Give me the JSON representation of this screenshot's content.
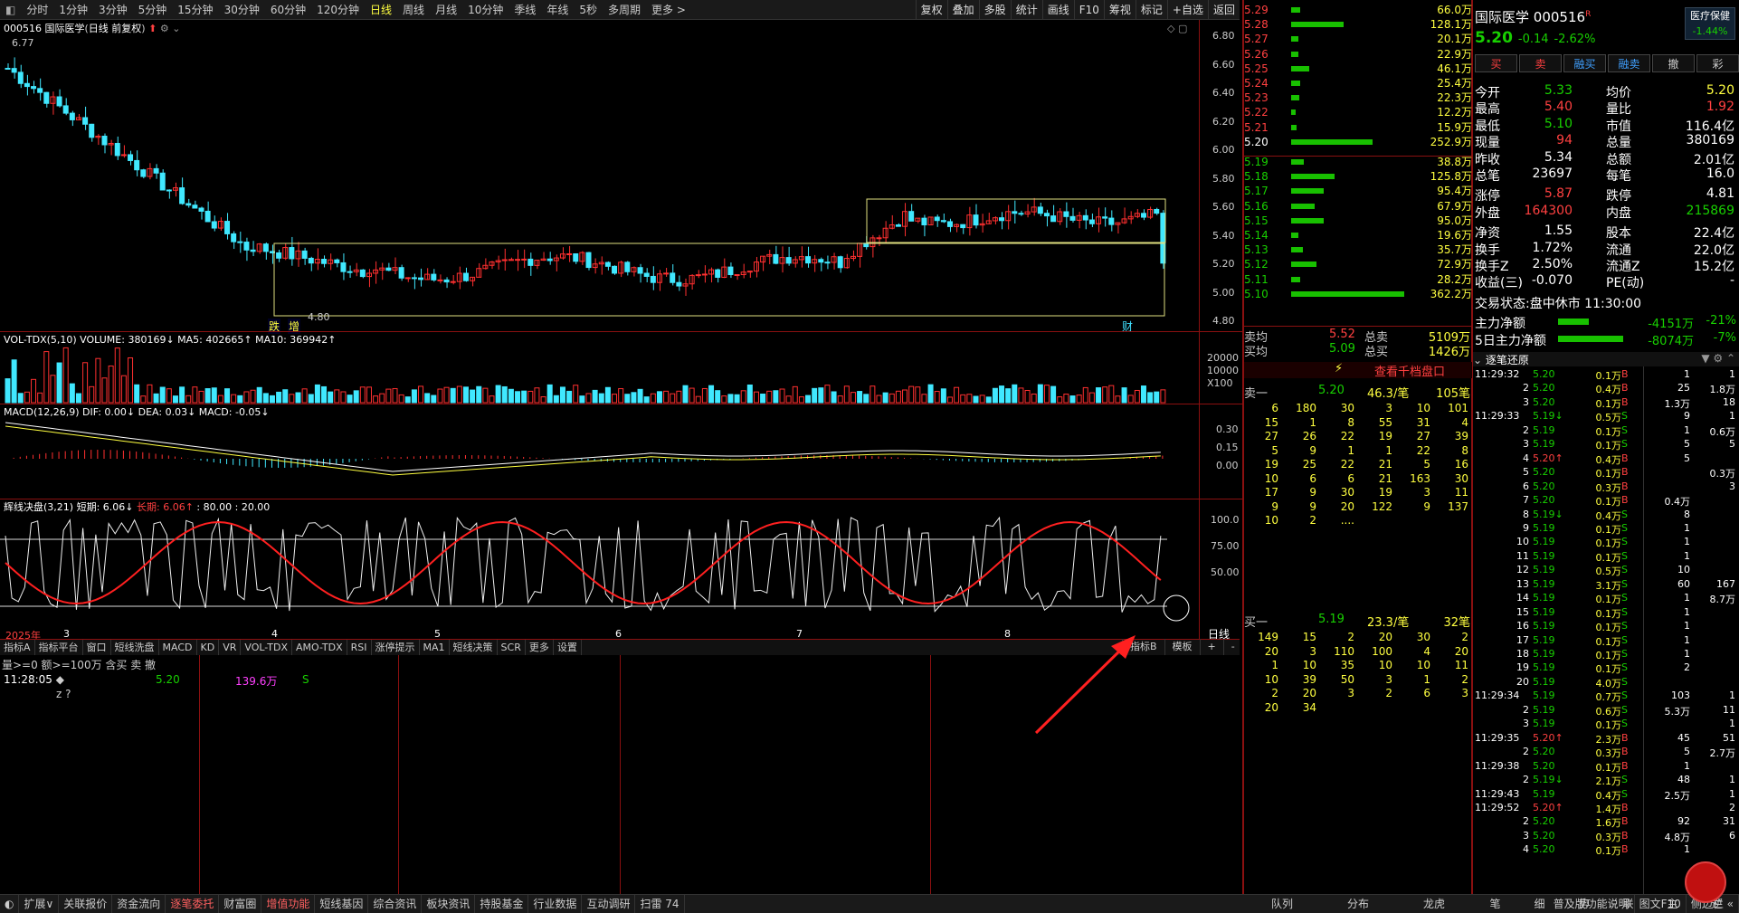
{
  "stock": {
    "code": "000516",
    "name": "国际医学",
    "chart_mode": "日线 前复权",
    "price": "5.20",
    "change": "-0.14",
    "pct": "-2.62%",
    "sector": "医疗保健",
    "sector_pct": "-1.44%"
  },
  "periods": [
    "分时",
    "1分钟",
    "3分钟",
    "5分钟",
    "15分钟",
    "30分钟",
    "60分钟",
    "120分钟",
    "日线",
    "周线",
    "月线",
    "10分钟",
    "季线",
    "年线",
    "5秒",
    "多周期",
    "更多 >"
  ],
  "period_current": "日线",
  "toolbar": [
    "复权",
    "叠加",
    "多股",
    "统计",
    "画线",
    "F10",
    "筹视",
    "标记",
    "+自选",
    "返回"
  ],
  "main_chart": {
    "price_labels": [
      "6.80",
      "6.60",
      "6.40",
      "6.20",
      "6.00",
      "5.80",
      "5.60",
      "5.40",
      "5.20",
      "5.00",
      "4.80"
    ],
    "high_label": "6.77",
    "low_label": "4.80",
    "markers": [
      "跌",
      "增",
      "财"
    ],
    "date_labels": [
      "2025年",
      "3",
      "4",
      "5",
      "6",
      "7",
      "8"
    ],
    "period_label": "日线"
  },
  "vol": {
    "header": "VOL-TDX(5,10) VOLUME: 380169↓ MA5: 402665↑ MA10: 369942↑",
    "labels": [
      "20000",
      "10000",
      "X100"
    ]
  },
  "macd": {
    "header": "MACD(12,26,9) DIF: 0.00↓ DEA: 0.03↓ MACD: -0.05↓",
    "labels": [
      "0.30",
      "0.15",
      "0.00"
    ]
  },
  "oscillator": {
    "name": "辉线决盘(3,21)",
    "short": "短期: 6.06↓",
    "long": "长期: 6.06↑",
    "levels": ": 80.00 : 20.00",
    "labels": [
      "100.0",
      "75.00",
      "50.00"
    ]
  },
  "ind_tabs": [
    "指标A",
    "指标平台",
    "窗口",
    "短线洗盘",
    "MACD",
    "KD",
    "VR",
    "VOL-TDX",
    "AMO-TDX",
    "RSI",
    "涨停提示",
    "MA1",
    "短线决策",
    "SCR",
    "更多",
    "设置"
  ],
  "ind_right": [
    "指标B",
    "模板",
    "+",
    "-"
  ],
  "filter": {
    "text": "量>=0 额>=100万 含买 卖 撤"
  },
  "filter_row": {
    "time": "11:28:05",
    "price": "5.20",
    "amount": "139.6万",
    "side": "S",
    "note": "z ?"
  },
  "bottom_tabs": [
    "扩展∨",
    "关联报价",
    "资金流向",
    "逐笔委托",
    "财富圈",
    "增值功能",
    "短线基因",
    "综合资讯",
    "板块资讯",
    "持股基金",
    "行业数据",
    "互动调研",
    "扫雷 74"
  ],
  "bottom_right": [
    "普及版功能说明",
    "图文F10",
    "侧边栏 «"
  ],
  "ob_bottom_tabs": [
    "队列",
    "分布",
    "龙虎"
  ],
  "tk_bottom_tabs": [
    "笔",
    "细",
    "势",
    "联",
    "主",
    "逆"
  ],
  "orderbook": [
    {
      "p": "5.29",
      "v": "66.0万",
      "w": 10
    },
    {
      "p": "5.28",
      "v": "128.1万",
      "w": 58
    },
    {
      "p": "5.27",
      "v": "20.1万",
      "w": 8
    },
    {
      "p": "5.26",
      "v": "22.9万",
      "w": 8
    },
    {
      "p": "5.25",
      "v": "46.1万",
      "w": 20
    },
    {
      "p": "5.24",
      "v": "25.4万",
      "w": 10
    },
    {
      "p": "5.23",
      "v": "22.3万",
      "w": 9
    },
    {
      "p": "5.22",
      "v": "12.2万",
      "w": 5
    },
    {
      "p": "5.21",
      "v": "15.9万",
      "w": 6
    },
    {
      "p": "5.20",
      "v": "252.9万",
      "w": 90
    },
    {
      "p": "5.19",
      "v": "38.8万",
      "w": 14
    },
    {
      "p": "5.18",
      "v": "125.8万",
      "w": 48
    },
    {
      "p": "5.17",
      "v": "95.4万",
      "w": 36
    },
    {
      "p": "5.16",
      "v": "67.9万",
      "w": 26
    },
    {
      "p": "5.15",
      "v": "95.0万",
      "w": 36
    },
    {
      "p": "5.14",
      "v": "19.6万",
      "w": 8
    },
    {
      "p": "5.13",
      "v": "35.7万",
      "w": 13
    },
    {
      "p": "5.12",
      "v": "72.9万",
      "w": 28
    },
    {
      "p": "5.11",
      "v": "28.2万",
      "w": 10
    },
    {
      "p": "5.10",
      "v": "362.2万",
      "w": 125
    }
  ],
  "ob_summary": {
    "sell_avg_label": "卖均",
    "sell_avg": "5.52",
    "sell_total_label": "总卖",
    "sell_total": "5109万",
    "buy_avg_label": "买均",
    "buy_avg": "5.09",
    "buy_total_label": "总买",
    "buy_total": "1426万",
    "link": "查看千档盘口"
  },
  "queue_sell": {
    "label": "卖一",
    "price": "5.20",
    "avg": "46.3/笔",
    "count": "105笔",
    "rows": [
      [
        "6",
        "180",
        "30",
        "3",
        "10",
        "101"
      ],
      [
        "15",
        "1",
        "8",
        "55",
        "31",
        "4"
      ],
      [
        "27",
        "26",
        "22",
        "19",
        "27",
        "39"
      ],
      [
        "5",
        "9",
        "1",
        "1",
        "22",
        "8"
      ],
      [
        "19",
        "25",
        "22",
        "21",
        "5",
        "16"
      ],
      [
        "10",
        "6",
        "6",
        "21",
        "163",
        "30"
      ],
      [
        "17",
        "9",
        "30",
        "19",
        "3",
        "11"
      ],
      [
        "9",
        "9",
        "20",
        "122",
        "9",
        "137"
      ],
      [
        "10",
        "2",
        "....",
        "",
        "",
        ""
      ]
    ]
  },
  "queue_buy": {
    "label": "买一",
    "price": "5.19",
    "avg": "23.3/笔",
    "count": "32笔",
    "rows": [
      [
        "149",
        "15",
        "2",
        "20",
        "30",
        "2"
      ],
      [
        "20",
        "3",
        "110",
        "100",
        "4",
        "20"
      ],
      [
        "1",
        "10",
        "35",
        "10",
        "10",
        "11"
      ],
      [
        "10",
        "39",
        "50",
        "3",
        "1",
        "2"
      ],
      [
        "2",
        "20",
        "3",
        "2",
        "6",
        "3"
      ],
      [
        "20",
        "34",
        "",
        "",
        "",
        ""
      ]
    ]
  },
  "trade_buttons": [
    "买",
    "卖",
    "融买",
    "融卖",
    "撤",
    "彩"
  ],
  "quote": [
    [
      "今开",
      "5.33",
      "均价",
      "5.20"
    ],
    [
      "最高",
      "5.40",
      "量比",
      "1.92"
    ],
    [
      "最低",
      "5.10",
      "市值",
      "116.4亿"
    ],
    [
      "现量",
      "94",
      "总量",
      "380169"
    ],
    [
      "昨收",
      "5.34",
      "总额",
      "2.01亿"
    ],
    [
      "总笔",
      "23697",
      "每笔",
      "16.0"
    ],
    [
      "涨停",
      "5.87",
      "跌停",
      "4.81"
    ],
    [
      "外盘",
      "164300",
      "内盘",
      "215869"
    ],
    [
      "净资",
      "1.55",
      "股本",
      "22.4亿"
    ],
    [
      "换手",
      "1.72%",
      "流通",
      "22.0亿"
    ],
    [
      "换手Z",
      "2.50%",
      "流通Z",
      "15.2亿"
    ],
    [
      "收益(三)",
      "-0.070",
      "PE(动)",
      "-"
    ]
  ],
  "status": {
    "label": "交易状态:",
    "value": "盘中休市 11:30:00"
  },
  "flow": [
    {
      "label": "主力净额",
      "value": "-4151万",
      "pct": "-21%"
    },
    {
      "label": "5日主力净额",
      "value": "-8074万",
      "pct": "-7%"
    }
  ],
  "ticks_title": "逐笔还原",
  "ticks": [
    {
      "t": "11:29:32",
      "p": "5.20",
      "v": "0.1万",
      "s": "B",
      "c": "1",
      "e": "1"
    },
    {
      "t": "2",
      "p": "5.20",
      "v": "0.4万",
      "s": "B",
      "c": "25",
      "e": "1.8万"
    },
    {
      "t": "3",
      "p": "5.20",
      "v": "0.1万",
      "s": "B",
      "c": "1.3万",
      "e": "18"
    },
    {
      "t": "11:29:33",
      "p": "5.19↓",
      "v": "0.5万",
      "s": "S",
      "c": "9",
      "e": "1"
    },
    {
      "t": "2",
      "p": "5.19",
      "v": "0.1万",
      "s": "S",
      "c": "1",
      "e": "0.6万"
    },
    {
      "t": "3",
      "p": "5.19",
      "v": "0.1万",
      "s": "S",
      "c": "5",
      "e": "5"
    },
    {
      "t": "4",
      "p": "5.20↑",
      "v": "0.4万",
      "s": "B",
      "c": "5",
      "e": ""
    },
    {
      "t": "5",
      "p": "5.20",
      "v": "0.1万",
      "s": "B",
      "c": "",
      "e": "0.3万"
    },
    {
      "t": "6",
      "p": "5.20",
      "v": "0.3万",
      "s": "B",
      "c": "",
      "e": "3"
    },
    {
      "t": "7",
      "p": "5.20",
      "v": "0.1万",
      "s": "B",
      "c": "0.4万",
      "e": ""
    },
    {
      "t": "8",
      "p": "5.19↓",
      "v": "0.4万",
      "s": "S",
      "c": "8",
      "e": ""
    },
    {
      "t": "9",
      "p": "5.19",
      "v": "0.1万",
      "s": "S",
      "c": "1",
      "e": ""
    },
    {
      "t": "10",
      "p": "5.19",
      "v": "0.1万",
      "s": "S",
      "c": "1",
      "e": ""
    },
    {
      "t": "11",
      "p": "5.19",
      "v": "0.1万",
      "s": "S",
      "c": "1",
      "e": ""
    },
    {
      "t": "12",
      "p": "5.19",
      "v": "0.5万",
      "s": "S",
      "c": "10",
      "e": ""
    },
    {
      "t": "13",
      "p": "5.19",
      "v": "3.1万",
      "s": "S",
      "c": "60",
      "e": "167"
    },
    {
      "t": "14",
      "p": "5.19",
      "v": "0.1万",
      "s": "S",
      "c": "1",
      "e": "8.7万"
    },
    {
      "t": "15",
      "p": "5.19",
      "v": "0.1万",
      "s": "S",
      "c": "1",
      "e": ""
    },
    {
      "t": "16",
      "p": "5.19",
      "v": "0.1万",
      "s": "S",
      "c": "1",
      "e": ""
    },
    {
      "t": "17",
      "p": "5.19",
      "v": "0.1万",
      "s": "S",
      "c": "1",
      "e": ""
    },
    {
      "t": "18",
      "p": "5.19",
      "v": "0.1万",
      "s": "S",
      "c": "1",
      "e": ""
    },
    {
      "t": "19",
      "p": "5.19",
      "v": "0.1万",
      "s": "S",
      "c": "2",
      "e": ""
    },
    {
      "t": "20",
      "p": "5.19",
      "v": "4.0万",
      "s": "S",
      "c": "",
      "e": ""
    },
    {
      "t": "11:29:34",
      "p": "5.19",
      "v": "0.7万",
      "s": "S",
      "c": "103",
      "e": "1"
    },
    {
      "t": "2",
      "p": "5.19",
      "v": "0.6万",
      "s": "S",
      "c": "5.3万",
      "e": "11"
    },
    {
      "t": "3",
      "p": "5.19",
      "v": "0.1万",
      "s": "S",
      "c": "",
      "e": "1"
    },
    {
      "t": "11:29:35",
      "p": "5.20↑",
      "v": "2.3万",
      "s": "B",
      "c": "45",
      "e": "51"
    },
    {
      "t": "2",
      "p": "5.20",
      "v": "0.3万",
      "s": "B",
      "c": "5",
      "e": "2.7万"
    },
    {
      "t": "11:29:38",
      "p": "5.20",
      "v": "0.1万",
      "s": "B",
      "c": "1",
      "e": ""
    },
    {
      "t": "2",
      "p": "5.19↓",
      "v": "2.1万",
      "s": "S",
      "c": "48",
      "e": "1"
    },
    {
      "t": "11:29:43",
      "p": "5.19",
      "v": "0.4万",
      "s": "S",
      "c": "2.5万",
      "e": "1"
    },
    {
      "t": "11:29:52",
      "p": "5.20↑",
      "v": "1.4万",
      "s": "B",
      "c": "",
      "e": "2"
    },
    {
      "t": "2",
      "p": "5.20",
      "v": "1.6万",
      "s": "B",
      "c": "92",
      "e": "31"
    },
    {
      "t": "3",
      "p": "5.20",
      "v": "0.3万",
      "s": "B",
      "c": "4.8万",
      "e": "6"
    },
    {
      "t": "4",
      "p": "5.20",
      "v": "0.1万",
      "s": "B",
      "c": "1",
      "e": ""
    }
  ],
  "colors": {
    "up": "#ff3030",
    "down": "#40e8ff",
    "frame": "#8a1010",
    "ma": "#ffff40",
    "price_cur": "#18d000"
  }
}
